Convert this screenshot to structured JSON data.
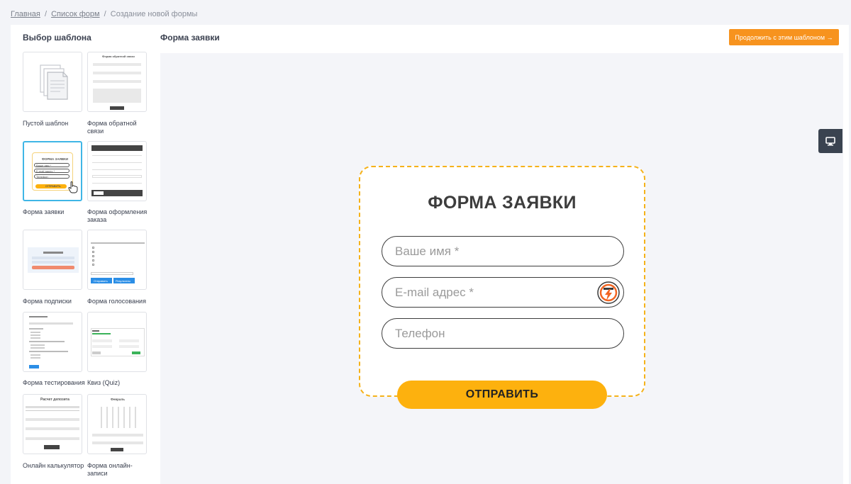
{
  "breadcrumb": {
    "home": "Главная",
    "forms_list": "Список форм",
    "current": "Создание новой формы",
    "separator": "/"
  },
  "sidebar": {
    "title": "Выбор шаблона",
    "templates": [
      {
        "label": "Пустой шаблон"
      },
      {
        "label": "Форма обратной связи"
      },
      {
        "label": "Форма заявки"
      },
      {
        "label": "Форма оформления заказа"
      },
      {
        "label": "Форма подписки"
      },
      {
        "label": "Форма голосования"
      },
      {
        "label": "Форма тестирования"
      },
      {
        "label": "Квиз (Quiz)"
      },
      {
        "label": "Онлайн калькулятор"
      },
      {
        "label": "Форма онлайн-записи"
      }
    ],
    "selected_index": 2
  },
  "main": {
    "title": "Форма заявки",
    "continue_button": "Продолжить с этим шаблоном →"
  },
  "preview_form": {
    "title": "ФОРМА ЗАЯВКИ",
    "name_placeholder": "Ваше имя *",
    "email_placeholder": "E-mail адрес *",
    "phone_placeholder": "Телефон",
    "submit_label": "ОТПРАВИТЬ"
  },
  "thumbs": {
    "feedback_title": "Форма обратной связи",
    "order_title": "ФОРМА ЗАЯВКИ",
    "order_name": "Ваше имя *",
    "order_email": "E-mail адрес *",
    "order_phone": "Телефон",
    "order_submit": "ОТПРАВИТЬ",
    "vote_send": "Отправить",
    "vote_results": "Результаты",
    "calc_title": "Расчет депозита",
    "booking_month": "Февраль"
  },
  "colors": {
    "accent": "#f7931e",
    "selected_border": "#3fb6e6",
    "form_border": "#f5b21a",
    "submit": "#fdb10e",
    "device_toggle": "#3a4350"
  },
  "icons": {
    "blank": "document-stack-icon",
    "device": "desktop-icon",
    "badge": "lightning-badge-icon",
    "cursor": "hand-cursor-icon"
  }
}
